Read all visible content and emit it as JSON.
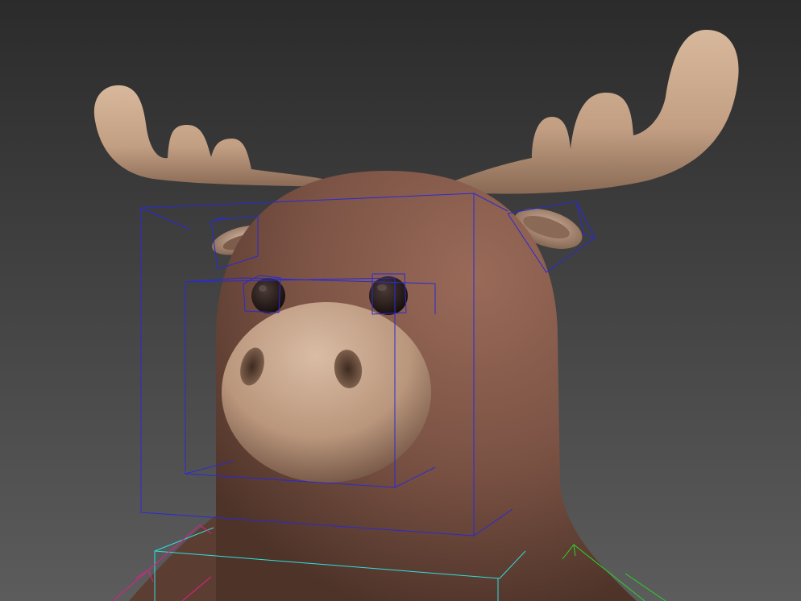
{
  "viewport": {
    "background_top": "#2b2b2b",
    "background_bottom": "#5c5c5c"
  },
  "model": {
    "body_color": "#7a5244",
    "body_highlight": "#9a6a58",
    "antler_color": "#c7a58a",
    "antler_shadow": "#8a6a55",
    "snout_color": "#b9967c",
    "eye_color": "#1f1412"
  },
  "rig": {
    "head_box_color": "#2a2ad6",
    "spine_box_color": "#2fe0e0",
    "left_arm_color": "#e0208a",
    "right_arm_color": "#28d428"
  }
}
